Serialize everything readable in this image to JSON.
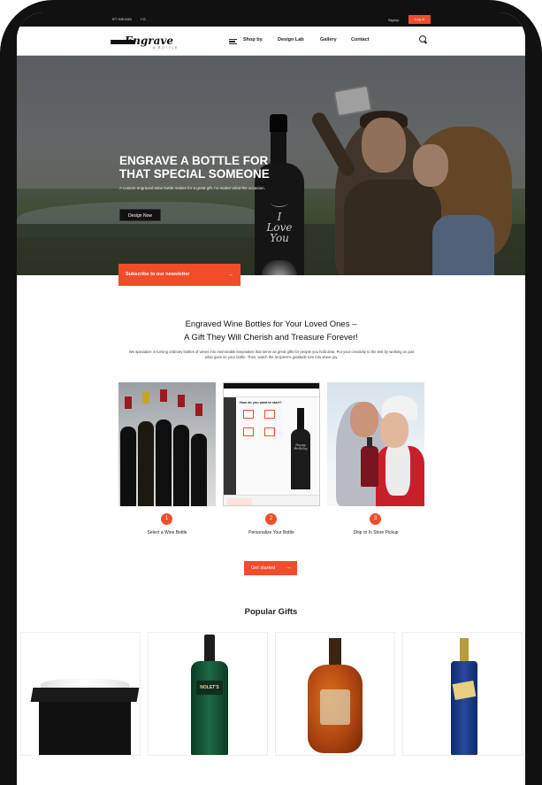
{
  "topbar": {
    "phone": "877-538-9463",
    "social": "f  ◎",
    "signup": "Signup",
    "login": "Log in"
  },
  "nav": {
    "logo_script": "Engrave",
    "logo_sub": "A BOTTLE",
    "menu_items": [
      "Shop by",
      "Design Lab",
      "Gallery",
      "Contact"
    ]
  },
  "hero": {
    "title": "ENGRAVE A BOTTLE FOR THAT SPECIAL SOMEONE",
    "subtitle": "A custom engraved wine bottle makes for a great gift, no matter what the occasion.",
    "button": "Design Now",
    "bottle_text": "I Love You"
  },
  "newsletter": {
    "label": "Subscribe to our newsletter",
    "arrow": "→"
  },
  "intro": {
    "title_line1": "Engraved Wine Bottles for Your Loved Ones –",
    "title_line2": "A Gift They Will Cherish and Treasure Forever!",
    "description": "We specialize in turning ordinary bottles of wines into memorable keepsakes that serve as great gifts for people you hold dear. Put your creativity to the test by working on just what goes on your bottle. Then, watch the recipient’s gratitude turn into sheer joy."
  },
  "steps": [
    {
      "num": "1",
      "label": "Select a Wine Bottle"
    },
    {
      "num": "2",
      "label": "Personalize Your Bottle"
    },
    {
      "num": "3",
      "label": "Ship or In Store Pickup"
    }
  ],
  "app_preview": {
    "question": "How do you want to start?",
    "bottle_text": "Happy Birthday"
  },
  "cta": {
    "label": "Get started",
    "arrow": "→"
  },
  "popular": {
    "title": "Popular Gifts",
    "nolets_label": "NOLET'S"
  },
  "colors": {
    "accent": "#f24c2a",
    "dark": "#111111"
  }
}
